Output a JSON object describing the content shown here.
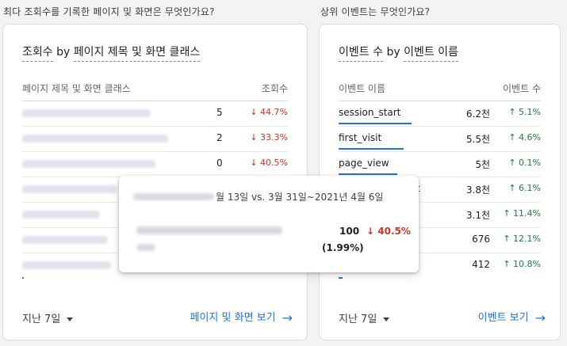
{
  "left": {
    "section_title": "최다 조회수를 기록한 페이지 및 화면은 무엇인가요?",
    "card_title_metric": "조회수",
    "card_title_by": "by",
    "card_title_dim": "페이지 제목 및 화면 클래스",
    "col_dim": "페이지 제목 및 화면 클래스",
    "col_metric": "조회수",
    "rows": [
      {
        "value_tail": "5",
        "change": "44.7%",
        "dir": "down"
      },
      {
        "value_tail": "2",
        "change": "33.3%",
        "dir": "down"
      },
      {
        "value_tail": "0",
        "change": "40.5%",
        "dir": "down"
      }
    ],
    "date_range": "지난 7일",
    "view_link": "페이지 및 화면 보기"
  },
  "right": {
    "section_title": "상위 이벤트는 무엇인가요?",
    "card_title_metric": "이벤트 수",
    "card_title_by": "by",
    "card_title_dim": "이벤트 이름",
    "col_dim": "이벤트 이름",
    "col_metric": "이벤트 수",
    "rows": [
      {
        "name": "session_start",
        "value": "6.2천",
        "change": "5.1%",
        "dir": "up"
      },
      {
        "name": "first_visit",
        "value": "5.5천",
        "change": "4.6%",
        "dir": "up"
      },
      {
        "name": "page_view",
        "value": "5천",
        "change": "0.1%",
        "dir": "up"
      },
      {
        "name": "t",
        "value": "3.8천",
        "change": "6.1%",
        "dir": "up"
      },
      {
        "name": "",
        "value": "3.1천",
        "change": "11.4%",
        "dir": "up"
      },
      {
        "name": "",
        "value": "676",
        "change": "12.1%",
        "dir": "up"
      },
      {
        "name": "",
        "value": "412",
        "change": "10.8%",
        "dir": "up"
      }
    ],
    "date_range": "지난 7일",
    "view_link": "이벤트 보기"
  },
  "tooltip": {
    "date_text": "월 13일 vs. 3월 31일~2021년 4월 6일",
    "value": "100",
    "change": "40.5%",
    "share": "(1.99%)"
  },
  "icons": {
    "up_arrow": "↑",
    "down_arrow": "↓",
    "right_arrow": "→"
  },
  "colors": {
    "accent": "#1a73e8",
    "up": "#188038",
    "down": "#d93025"
  }
}
